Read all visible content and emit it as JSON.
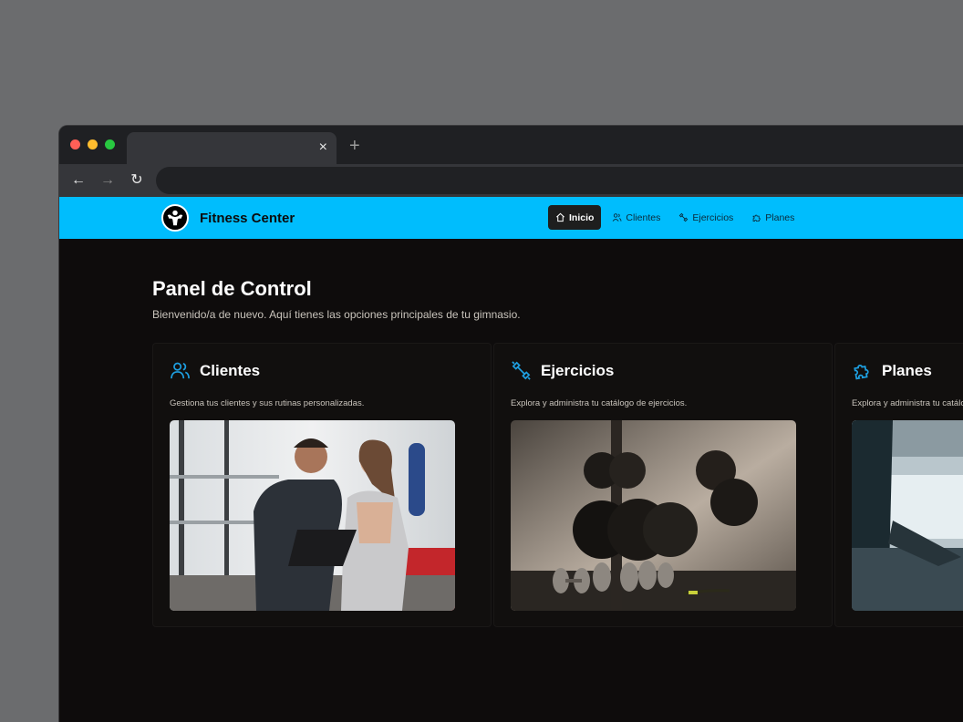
{
  "browser": {
    "tab_close": "×",
    "new_tab": "+",
    "back": "←",
    "forward": "→",
    "reload": "↻"
  },
  "app": {
    "brand_name": "Fitness Center",
    "nav": [
      {
        "label": "Inicio",
        "icon": "home-icon",
        "active": true
      },
      {
        "label": "Clientes",
        "icon": "users-icon",
        "active": false
      },
      {
        "label": "Ejercicios",
        "icon": "dumbbell-icon",
        "active": false
      },
      {
        "label": "Planes",
        "icon": "puzzle-icon",
        "active": false
      }
    ],
    "accent_color": "#00bdfd"
  },
  "page": {
    "title": "Panel de Control",
    "subtitle": "Bienvenido/a de nuevo. Aquí tienes las opciones principales de tu gimnasio."
  },
  "cards": [
    {
      "title": "Clientes",
      "icon": "users-icon",
      "description": "Gestiona tus clientes y sus rutinas personalizadas.",
      "image": "trainer-and-client-photo"
    },
    {
      "title": "Ejercicios",
      "icon": "dumbbell-icon",
      "description": "Explora y administra tu catálogo de ejercicios.",
      "image": "dumbbell-rack-photo"
    },
    {
      "title": "Planes",
      "icon": "puzzle-icon",
      "description": "Explora y administra tu catálogo de planes.",
      "image": "gym-interior-photo"
    }
  ],
  "card_icon_color": "#1e9fe0"
}
